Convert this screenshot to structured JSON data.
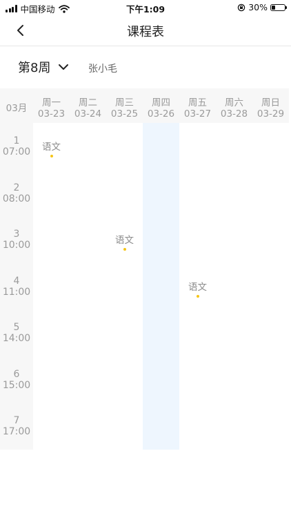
{
  "status_bar": {
    "carrier": "中国移动",
    "time": "下午1:09",
    "battery": "30%",
    "battery_level": 0.3
  },
  "nav": {
    "title": "课程表"
  },
  "week": {
    "label": "第8周",
    "student": "张小毛"
  },
  "schedule": {
    "month": "03月",
    "days": [
      {
        "name": "周一",
        "date": "03-23"
      },
      {
        "name": "周二",
        "date": "03-24"
      },
      {
        "name": "周三",
        "date": "03-25"
      },
      {
        "name": "周四",
        "date": "03-26"
      },
      {
        "name": "周五",
        "date": "03-27"
      },
      {
        "name": "周六",
        "date": "03-28"
      },
      {
        "name": "周日",
        "date": "03-29"
      }
    ],
    "periods": [
      {
        "num": "1",
        "time": "07:00"
      },
      {
        "num": "2",
        "time": "08:00"
      },
      {
        "num": "3",
        "time": "10:00"
      },
      {
        "num": "4",
        "time": "11:00"
      },
      {
        "num": "5",
        "time": "14:00"
      },
      {
        "num": "6",
        "time": "15:00"
      },
      {
        "num": "7",
        "time": "17:00"
      }
    ],
    "highlighted_day_index": 3,
    "lessons": [
      {
        "day": 0,
        "period": 0,
        "name": "语文"
      },
      {
        "day": 2,
        "period": 2,
        "name": "语文"
      },
      {
        "day": 4,
        "period": 3,
        "name": "语文"
      }
    ],
    "colors": {
      "highlight": "#eef6fe",
      "lesson_dot": "#f5c518"
    }
  }
}
